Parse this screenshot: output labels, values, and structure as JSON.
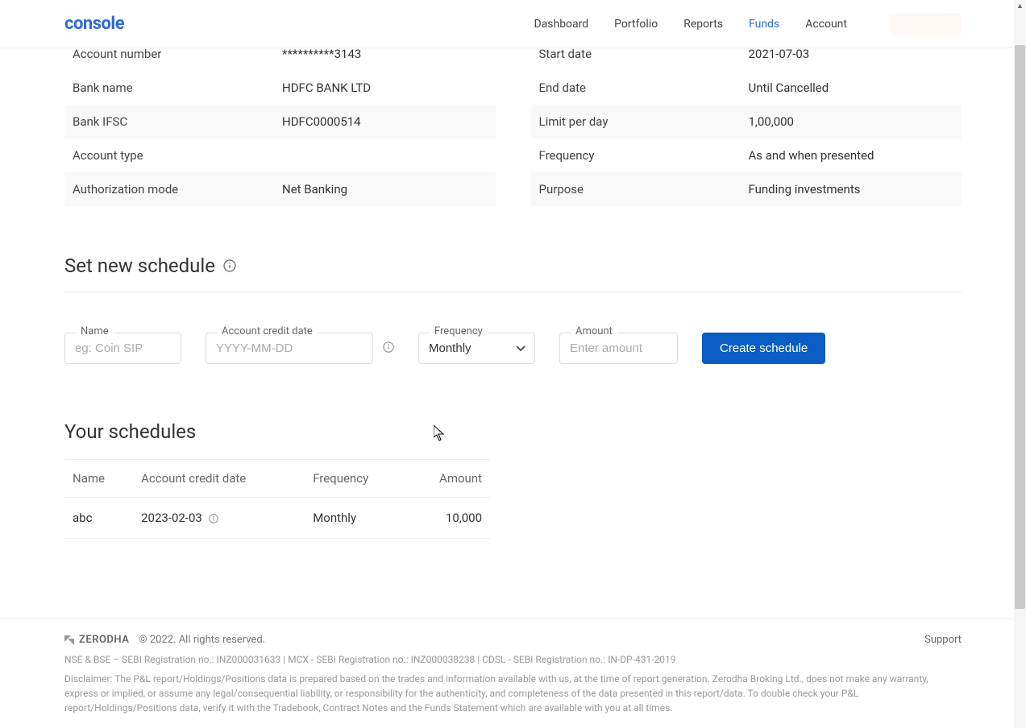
{
  "logo": "console",
  "nav": {
    "dashboard": "Dashboard",
    "portfolio": "Portfolio",
    "reports": "Reports",
    "funds": "Funds",
    "account": "Account"
  },
  "bank_details": {
    "left": [
      {
        "label": "Account number",
        "value": "**********3143"
      },
      {
        "label": "Bank name",
        "value": "HDFC BANK LTD"
      },
      {
        "label": "Bank IFSC",
        "value": "HDFC0000514"
      },
      {
        "label": "Account type",
        "value": ""
      },
      {
        "label": "Authorization mode",
        "value": "Net Banking"
      }
    ],
    "right": [
      {
        "label": "Start date",
        "value": "2021-07-03"
      },
      {
        "label": "End date",
        "value": "Until Cancelled"
      },
      {
        "label": "Limit per day",
        "value": "1,00,000"
      },
      {
        "label": "Frequency",
        "value": "As and when presented"
      },
      {
        "label": "Purpose",
        "value": "Funding investments"
      }
    ]
  },
  "schedule_form": {
    "title": "Set new schedule",
    "name_label": "Name",
    "name_placeholder": "eg: Coin SIP",
    "date_label": "Account credit date",
    "date_placeholder": "YYYY-MM-DD",
    "freq_label": "Frequency",
    "freq_value": "Monthly",
    "amount_label": "Amount",
    "amount_placeholder": "Enter amount",
    "submit": "Create schedule"
  },
  "schedules": {
    "title": "Your schedules",
    "headers": {
      "name": "Name",
      "date": "Account credit date",
      "freq": "Frequency",
      "amount": "Amount"
    },
    "rows": [
      {
        "name": "abc",
        "date": "2023-02-03",
        "freq": "Monthly",
        "amount": "10,000"
      }
    ]
  },
  "footer": {
    "brand": "ZERODHA",
    "copyright": "© 2022. All rights reserved.",
    "support": "Support",
    "registration": "NSE & BSE – SEBI Registration no.: INZ000031633 | MCX - SEBI Registration no.: INZ000038238 | CDSL - SEBI Registration no.: IN-DP-431-2019",
    "disclaimer": "Disclaimer: The P&L report/Holdings/Positions data is prepared based on the trades and information available with us, at the time of report generation. Zerodha Broking Ltd., does not make any warranty, express or implied, or assume any legal/consequential liability, or responsibility for the authenticity, and completeness of the data presented in this report/data. To double check your P&L report/Holdings/Positions data, verify it with the Tradebook, Contract Notes and the Funds Statement which are available with you at all times."
  }
}
